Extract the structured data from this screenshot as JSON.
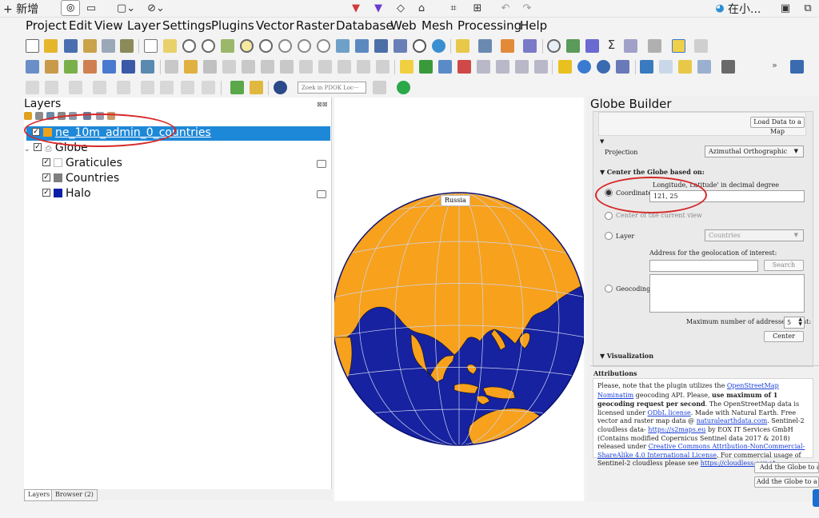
{
  "snipbar": {
    "new_label": "+ 新增",
    "right_label": "在小...",
    "accent_flag_red": "#d03a3a",
    "accent_flag_purple": "#6a3ad0"
  },
  "menu": [
    "Project",
    "Edit",
    "View",
    "Layer",
    "Settings",
    "Plugins",
    "Vector",
    "Raster",
    "Database",
    "Web",
    "Mesh",
    "Processing",
    "Help"
  ],
  "toolbar": {
    "locator_placeholder": "Zoek in PDOK Loc···"
  },
  "layers_panel": {
    "title": "Layers",
    "items": [
      {
        "name": "ne_10m_admin_0_countries",
        "checked": "✓",
        "color": "#f0a21c",
        "selected": true
      },
      {
        "name": "Globe",
        "checked": "✓",
        "group": true
      },
      {
        "name": "Graticules",
        "checked": "✓",
        "color": "#ffffff"
      },
      {
        "name": "Countries",
        "checked": "✓",
        "color": "#7f7f7f"
      },
      {
        "name": "Halo",
        "checked": "✓",
        "color": "#0a1fa6"
      }
    ],
    "tabs": [
      "Layers",
      "Browser (2)"
    ]
  },
  "map": {
    "label": "Russia",
    "ocean_color": "#1722a0",
    "land_color": "#f7a11d"
  },
  "globe_builder": {
    "title": "Globe Builder",
    "load_button": "Load Data to a Map",
    "projection_label": "Projection",
    "projection_value": "Azimuthal Orthographic",
    "center_section": "Center the Globe based on:",
    "coord_hint": "Longitude, Latitude' in decimal degree",
    "coordinates_label": "Coordinates",
    "coordinates_value": "121, 25",
    "center_view_label": "Center of the current view",
    "layer_label": "Layer",
    "layer_value": "Countries",
    "address_label": "Address for the geolocation of interest:",
    "search_button": "Search",
    "geocoding_label": "Geocoding",
    "max_label": "Maximum number of addresses to list:",
    "max_value": "5",
    "center_button": "Center",
    "visualization_section": "Visualization",
    "attributions_title": "Attributions",
    "attr_1": "Please, note that the plugin utilizes the ",
    "attr_link1": "OpenStreetMap Nominatim",
    "attr_2": " geocoding API. Please, ",
    "attr_bold": "use maximum of 1 geocoding request per second",
    "attr_3": ". The OpenStreetMap data is licensed under ",
    "attr_link2": "ODbL license",
    "attr_4": ". Made with Natural Earth. Free vector and raster map data @ ",
    "attr_link3": "naturalearthdata.com",
    "attr_5": ". Sentinel-2 cloudless data- ",
    "attr_link4": "https://s2maps.eu",
    "attr_6": " by EOX IT Services GmbH (Contains modified Copernicus Sentinel data 2017 & 2018) released under ",
    "attr_link5": "Creative Commons Attribution-NonCommercial-ShareAlike 4.0 International License",
    "attr_7": ". For commercial usage of Sentinel-2 cloudless please see ",
    "attr_link6": "https://cloudless.eox.at",
    "attr_8": ".",
    "add_globe_map": "Add the Globe to a Map",
    "add_globe_layout": "Add the Globe to a Layout"
  }
}
